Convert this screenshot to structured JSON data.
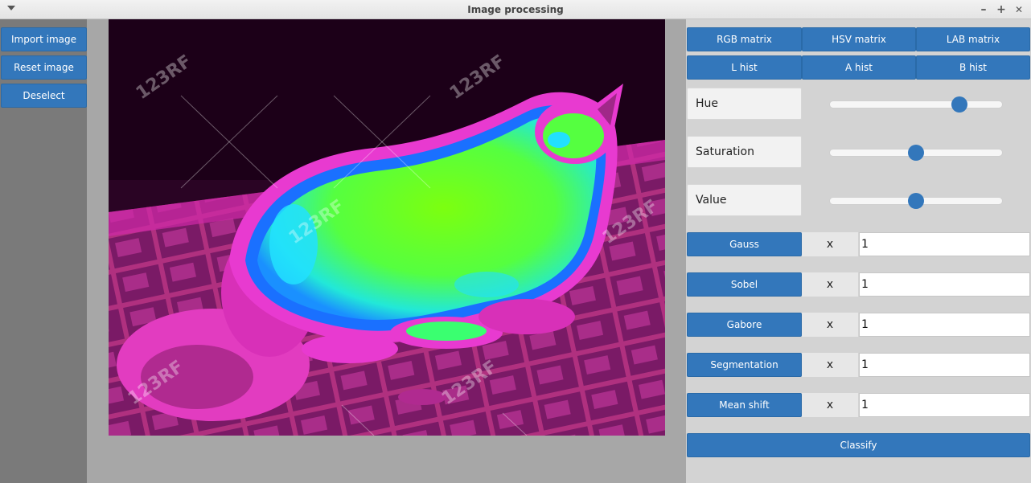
{
  "window": {
    "title": "Image processing",
    "menu_icon": "chevron-down-icon",
    "minimize_glyph": "–",
    "maximize_glyph": "+",
    "close_glyph": "✕"
  },
  "left_panel": {
    "import_label": "Import image",
    "reset_label": "Reset image",
    "deselect_label": "Deselect"
  },
  "image": {
    "watermark_text": "123RF"
  },
  "right_panel": {
    "matrix_buttons": [
      "RGB matrix",
      "HSV matrix",
      "LAB matrix"
    ],
    "hist_buttons": [
      "L hist",
      "A hist",
      "B hist"
    ],
    "sliders": [
      {
        "label": "Hue",
        "level": 0.75
      },
      {
        "label": "Saturation",
        "level": 0.5
      },
      {
        "label": "Value",
        "level": 0.5
      }
    ],
    "filters": [
      {
        "label": "Gauss",
        "x": "x",
        "value": "1"
      },
      {
        "label": "Sobel",
        "x": "x",
        "value": "1"
      },
      {
        "label": "Gabore",
        "x": "x",
        "value": "1"
      },
      {
        "label": "Segmentation",
        "x": "x",
        "value": "1"
      },
      {
        "label": "Mean shift",
        "x": "x",
        "value": "1"
      }
    ],
    "classify_label": "Classify"
  },
  "colors": {
    "button_blue": "#3377bb",
    "left_panel": "#7a7a7a",
    "center_bg": "#a7a7a7",
    "right_panel": "#d3d3d3",
    "magenta": "#e020c0",
    "green": "#66ff22",
    "cyan": "#22e0ff"
  }
}
